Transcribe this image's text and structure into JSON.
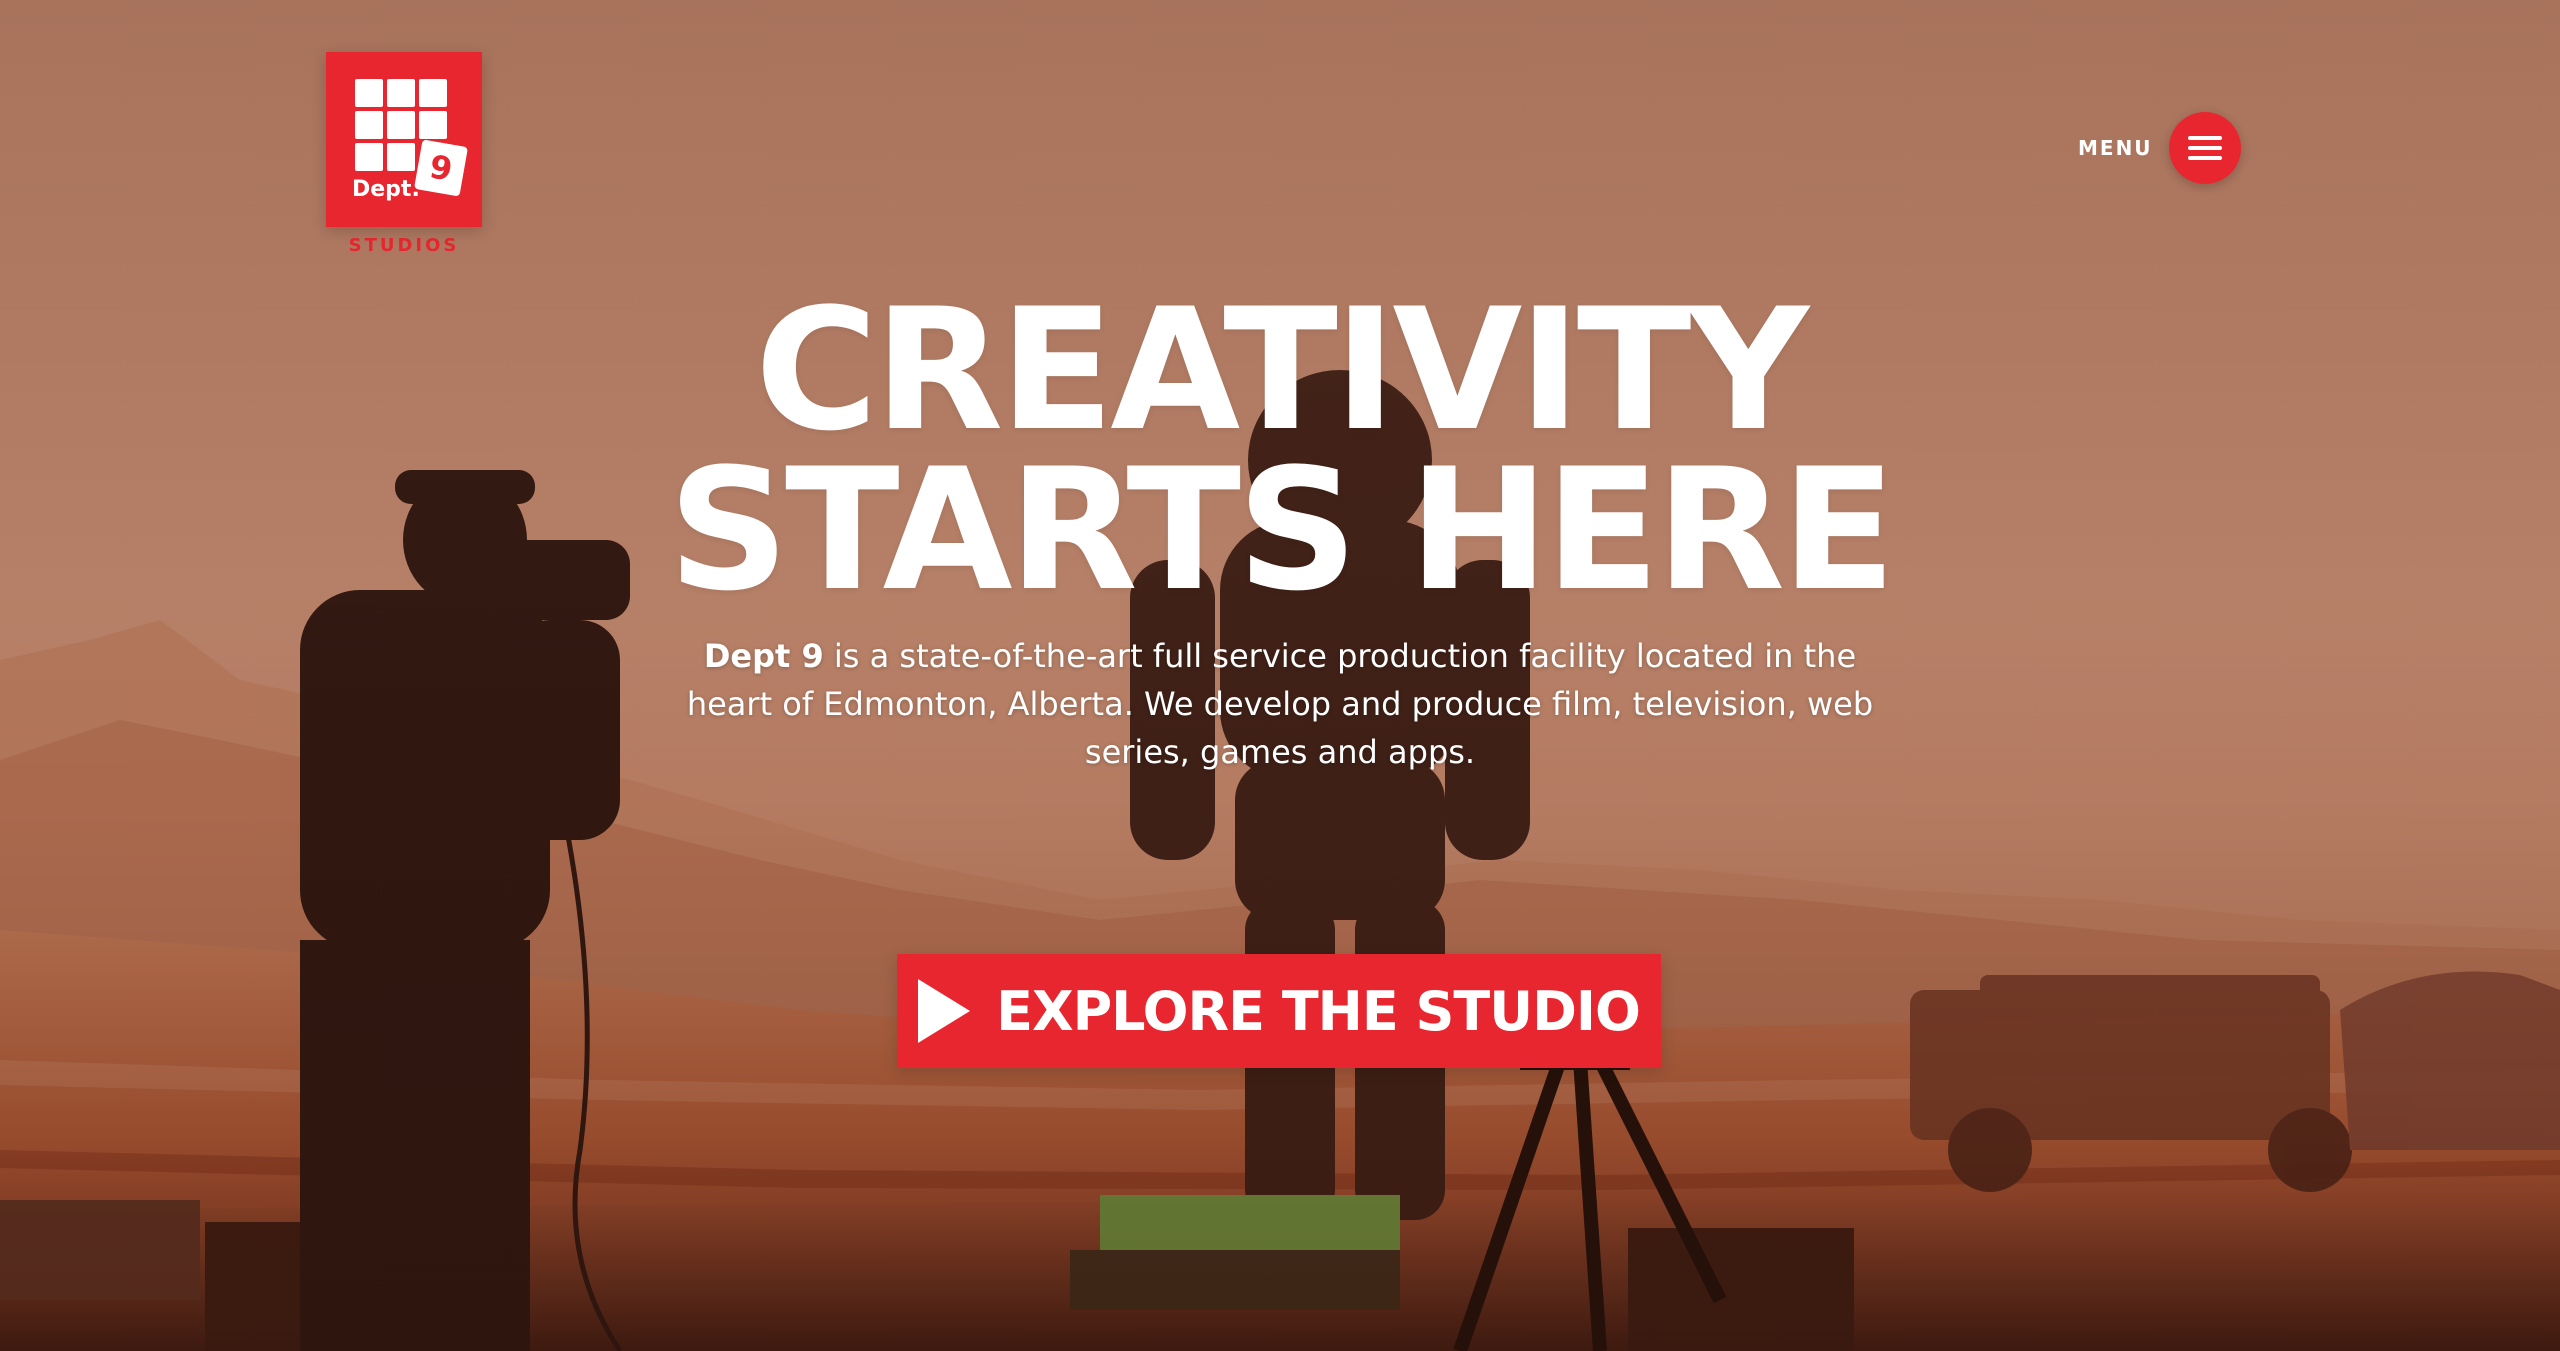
{
  "brand": {
    "logo_text": "Dept.",
    "logo_number": "9",
    "logo_subtitle": "STUDIOS",
    "accent_color": "#e8262f"
  },
  "menu": {
    "label": "MENU",
    "icon": "hamburger-icon"
  },
  "hero": {
    "title_line1": "CREATIVITY",
    "title_line2": "STARTS HERE",
    "desc_bold": "Dept 9",
    "desc_rest": " is a state-of-the-art full service production facility located in the heart of Edmonton, Alberta. We develop and produce film, television, web series, games and apps."
  },
  "cta": {
    "label": "EXPLORE THE STUDIO",
    "icon": "play-icon"
  },
  "background": {
    "description_icon": "film-set-background"
  }
}
